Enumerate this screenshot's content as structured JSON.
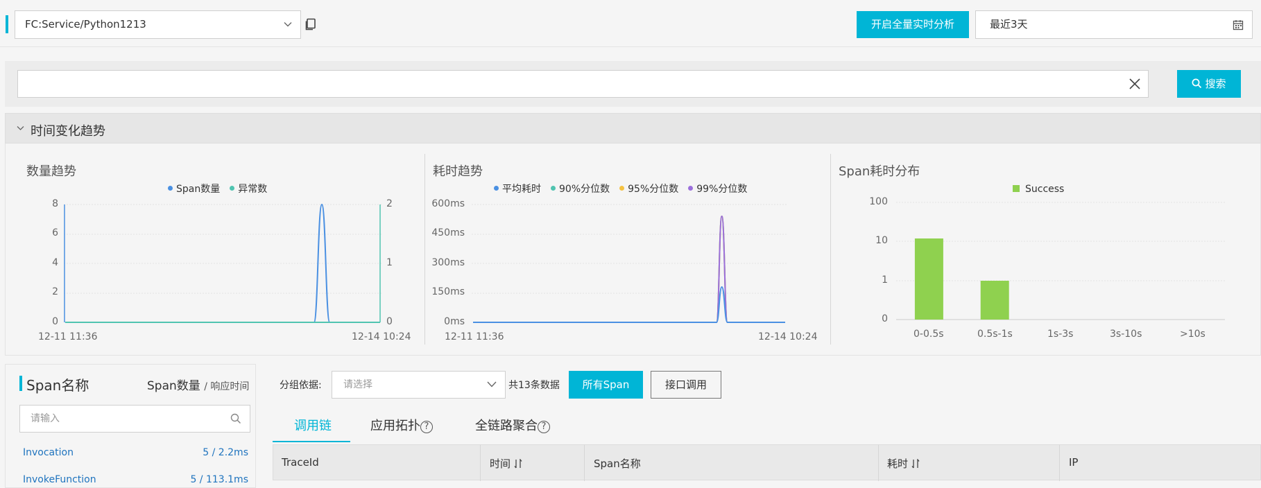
{
  "header": {
    "service": "FC:Service/Python1213",
    "realtime_button": "开启全量实时分析",
    "time_range": "最近3天"
  },
  "search": {
    "value": "",
    "button": "搜索"
  },
  "trend_section": {
    "title": "时间变化趋势"
  },
  "charts": {
    "count": {
      "title": "数量趋势",
      "legend": [
        "Span数量",
        "异常数"
      ],
      "y_left_ticks": [
        "8",
        "6",
        "4",
        "2",
        "0"
      ],
      "y_right_ticks": [
        "2",
        "1",
        "0"
      ],
      "x_ticks": [
        "12-11 11:36",
        "12-14 10:24"
      ]
    },
    "latency": {
      "title": "耗时趋势",
      "legend": [
        "平均耗时",
        "90%分位数",
        "95%分位数",
        "99%分位数"
      ],
      "y_ticks": [
        "600ms",
        "450ms",
        "300ms",
        "150ms",
        "0ms"
      ],
      "x_ticks": [
        "12-11 11:36",
        "12-14 10:24"
      ]
    },
    "distribution": {
      "title": "Span耗时分布",
      "legend": [
        "Success"
      ],
      "y_ticks": [
        "100",
        "10",
        "1",
        "0"
      ],
      "x_ticks": [
        "0-0.5s",
        "0.5s-1s",
        "1s-3s",
        "3s-10s",
        ">10s"
      ]
    }
  },
  "chart_data": [
    {
      "type": "line",
      "title": "数量趋势",
      "x_range": [
        "12-11 11:36",
        "12-14 10:24"
      ],
      "ylim": [
        0,
        8
      ],
      "y2lim": [
        0,
        2
      ],
      "series": [
        {
          "name": "Span数量",
          "axis": "left",
          "x": [
            0,
            0.76,
            0.79,
            0.815,
            0.84,
            0.87,
            1.0
          ],
          "values": [
            0,
            0,
            0,
            8,
            0,
            0,
            0
          ]
        },
        {
          "name": "异常数",
          "axis": "right",
          "x": [
            0,
            1.0
          ],
          "values": [
            0,
            0
          ]
        }
      ],
      "colors": {
        "Span数量": "#4a90e2",
        "异常数": "#50c4b0"
      }
    },
    {
      "type": "line",
      "title": "耗时趋势",
      "x_range": [
        "12-11 11:36",
        "12-14 10:24"
      ],
      "ylim": [
        0,
        600
      ],
      "series": [
        {
          "name": "平均耗时",
          "x": [
            0,
            0.76,
            0.78,
            0.797,
            0.815,
            0.83,
            1.0
          ],
          "values": [
            0,
            0,
            0,
            180,
            0,
            0,
            0
          ]
        },
        {
          "name": "90%分位数",
          "x": [
            0,
            0.76,
            0.78,
            0.797,
            0.815,
            0.83,
            1.0
          ],
          "values": [
            0,
            0,
            0,
            540,
            0,
            0,
            0
          ]
        },
        {
          "name": "95%分位数",
          "x": [
            0,
            0.76,
            0.78,
            0.797,
            0.815,
            0.83,
            1.0
          ],
          "values": [
            0,
            0,
            0,
            540,
            0,
            0,
            0
          ]
        },
        {
          "name": "99%分位数",
          "x": [
            0,
            0.76,
            0.78,
            0.797,
            0.815,
            0.83,
            1.0
          ],
          "values": [
            0,
            0,
            0,
            540,
            0,
            0,
            0
          ]
        }
      ],
      "colors": {
        "平均耗时": "#4a90e2",
        "90%分位数": "#50c4b0",
        "95%分位数": "#f5c242",
        "99%分位数": "#9b6fdc"
      }
    },
    {
      "type": "bar",
      "title": "Span耗时分布",
      "scale": "log",
      "categories": [
        "0-0.5s",
        "0.5s-1s",
        "1s-3s",
        "3s-10s",
        ">10s"
      ],
      "series": [
        {
          "name": "Success",
          "values": [
            12,
            1,
            0,
            0,
            0
          ]
        }
      ],
      "colors": {
        "Success": "#8fd14f"
      }
    }
  ],
  "span_panel": {
    "title": "Span名称",
    "count_header": "Span数量",
    "count_header_sub": "/ 响应时间",
    "filter_placeholder": "请输入",
    "items": [
      {
        "name": "Invocation",
        "value": "5 / 2.2ms"
      },
      {
        "name": "InvokeFunction",
        "value": "5 / 113.1ms"
      }
    ]
  },
  "toolbar": {
    "group_label": "分组依据:",
    "group_placeholder": "请选择",
    "count_text": "共13条数据",
    "all_span": "所有Span",
    "api_call": "接口调用"
  },
  "tabs": [
    "调用链",
    "应用拓扑",
    "全链路聚合"
  ],
  "table": {
    "columns": [
      "TraceId",
      "时间",
      "Span名称",
      "耗时",
      "IP"
    ]
  }
}
